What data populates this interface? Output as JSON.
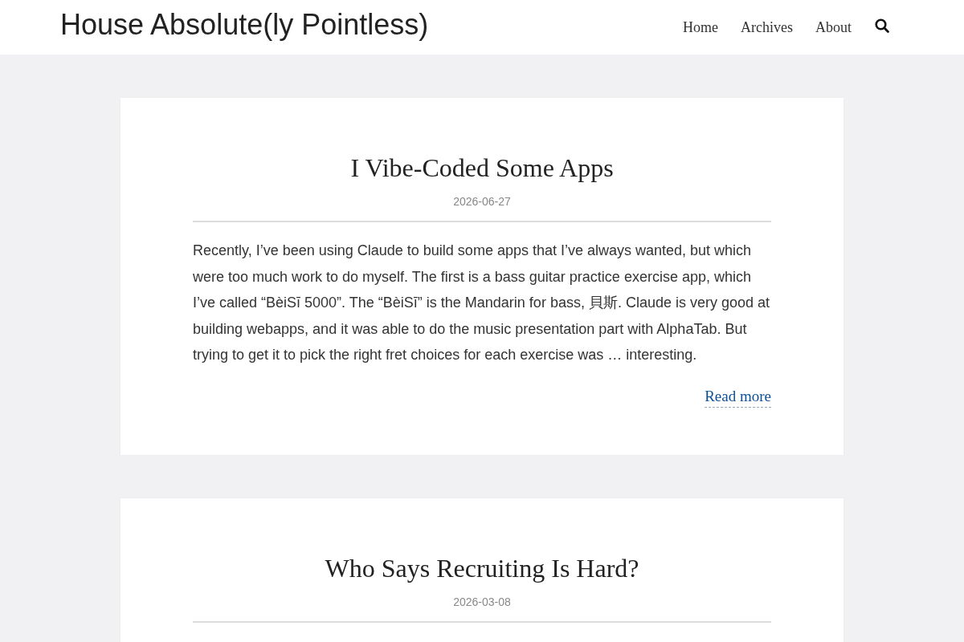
{
  "header": {
    "site_title": "House Absolute(ly Pointless)",
    "nav": [
      {
        "label": "Home"
      },
      {
        "label": "Archives"
      },
      {
        "label": "About"
      }
    ]
  },
  "posts": [
    {
      "title": "I Vibe-Coded Some Apps",
      "date": "2026-06-27",
      "excerpt": "Recently, I’ve been using Claude to build some apps that I’ve always wanted, but which were too much work to do myself. The first is a bass guitar practice exercise app, which I’ve called “BèiSī 5000”. The “BèiSī” is the Mandarin for bass, 貝斯. Claude is very good at building webapps, and it was able to do the music presentation part with AlphaTab. But trying to get it to pick the right fret choices for each exercise was … interesting.",
      "read_more": "Read more"
    },
    {
      "title": "Who Says Recruiting Is Hard?",
      "date": "2026-03-08"
    }
  ]
}
